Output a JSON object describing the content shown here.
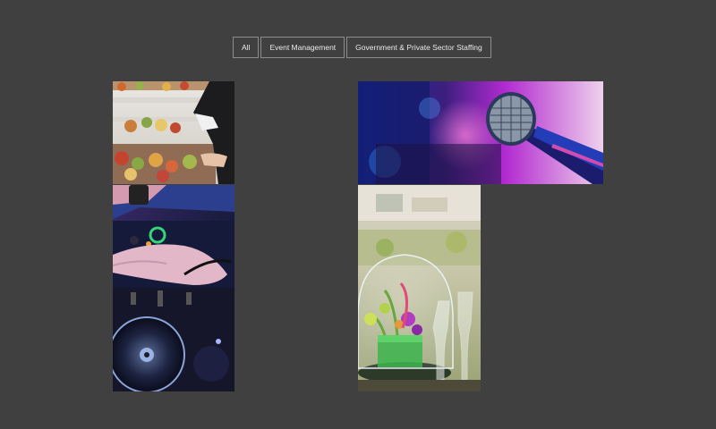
{
  "filters": {
    "all": "All",
    "event_management": "Event Management",
    "staffing": "Government & Private Sector Staffing"
  },
  "gallery": {
    "items": [
      {
        "subject": "catering-buffet-photo"
      },
      {
        "subject": "dj-mixer-photo"
      },
      {
        "subject": "microphone-stage-photo"
      },
      {
        "subject": "glass-terrarium-centerpiece-photo"
      }
    ]
  },
  "colors": {
    "background": "#404041",
    "button_border": "#8c8c8c",
    "button_text": "#e9e9e9"
  }
}
